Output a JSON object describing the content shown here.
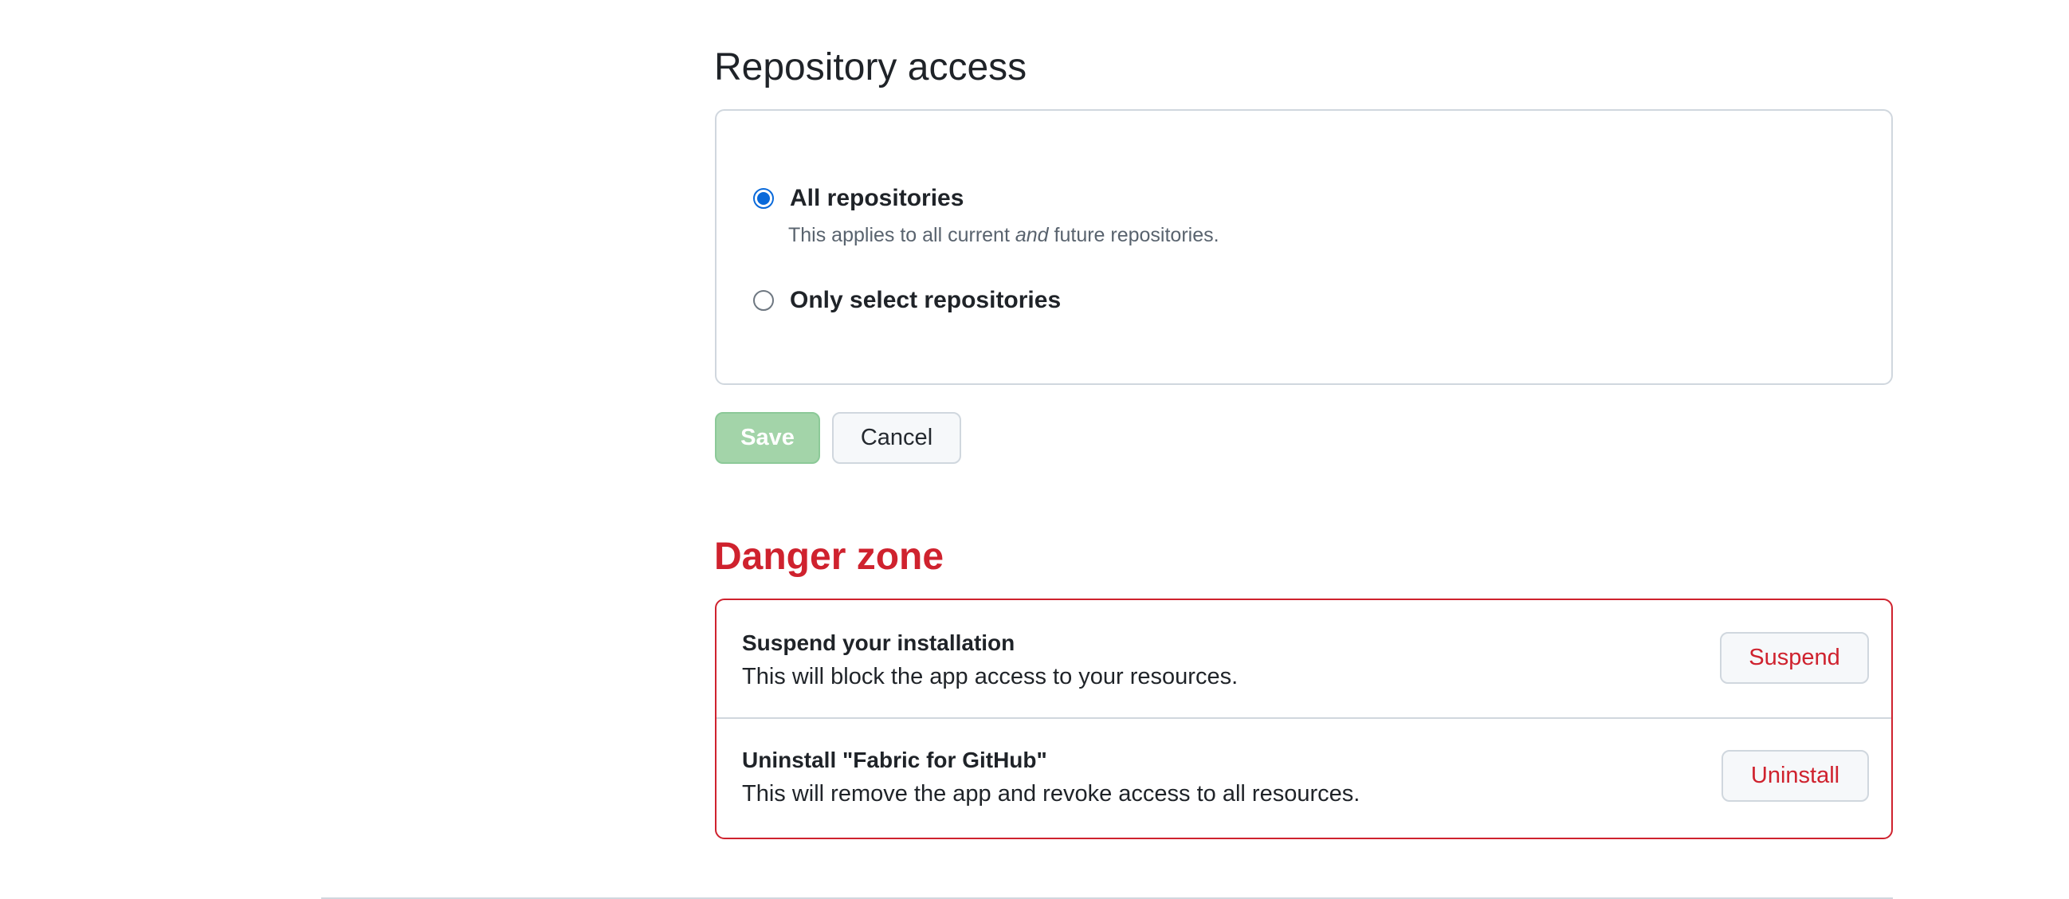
{
  "repository_access": {
    "title": "Repository access",
    "options": [
      {
        "label": "All repositories",
        "selected": true,
        "help_prefix": "This applies to all current ",
        "help_emphasis": "and",
        "help_suffix": " future repositories."
      },
      {
        "label": "Only select repositories",
        "selected": false
      }
    ]
  },
  "actions": {
    "save_label": "Save",
    "cancel_label": "Cancel"
  },
  "danger_zone": {
    "title": "Danger zone",
    "items": [
      {
        "title": "Suspend your installation",
        "description": "This will block the app access to your resources.",
        "button_label": "Suspend"
      },
      {
        "title": "Uninstall \"Fabric for GitHub\"",
        "description": "This will remove the app and revoke access to all resources.",
        "button_label": "Uninstall"
      }
    ]
  },
  "colors": {
    "danger": "#cf222e",
    "accent": "#0969da",
    "save_disabled_bg": "#a3d4a9",
    "border": "#d0d7de"
  }
}
